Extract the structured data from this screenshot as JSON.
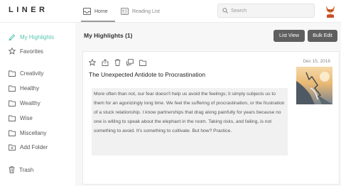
{
  "app": {
    "logo": "LINER"
  },
  "nav": {
    "tabs": [
      {
        "label": "Home",
        "icon": "inbox-icon",
        "active": true
      },
      {
        "label": "Reading List",
        "icon": "newspaper-icon",
        "active": false
      }
    ]
  },
  "search": {
    "placeholder": "Search",
    "value": ""
  },
  "user": {
    "avatar_icon": "fox-avatar"
  },
  "sidebar": {
    "items": [
      {
        "label": "My Highlights",
        "icon": "highlighter-icon",
        "active": true
      },
      {
        "label": "Favorites",
        "icon": "star-icon"
      },
      {
        "label": "Creativity",
        "icon": "folder-icon"
      },
      {
        "label": "Healthy",
        "icon": "folder-icon"
      },
      {
        "label": "Wealthy",
        "icon": "folder-icon"
      },
      {
        "label": "Wise",
        "icon": "folder-icon"
      },
      {
        "label": "Miscellany",
        "icon": "folder-icon"
      },
      {
        "label": "Add Folder",
        "icon": "folder-plus-icon"
      },
      {
        "label": "Trash",
        "icon": "trash-icon"
      }
    ]
  },
  "main": {
    "title": "My Highlights (1)",
    "list_view_label": "List View",
    "bulk_edit_label": "Bulk Edit"
  },
  "card": {
    "date": "Dec 15, 2016",
    "title": "The Unexpected Antidote to Procrastination",
    "quote": "More often than not, our fear doesn't help us avoid the feelings; it simply subjects us to them for an agonizingly long time. We feel the suffering of procrastination, or the frustration of a stuck relationship. I know partnerships that drag along painfully for years because no one is willing to speak about the elephant in the room. Taking risks, and failing, is not something to avoid. It's something to cultivate. But how? Practice.",
    "actions": [
      "star-icon",
      "share-icon",
      "delete-icon",
      "comment-icon",
      "folder-icon"
    ]
  },
  "colors": {
    "accent": "#56c5b0",
    "button": "#5f5f5f",
    "main_bg": "#f7f7f7",
    "quote_bg": "#f1f1f1"
  }
}
